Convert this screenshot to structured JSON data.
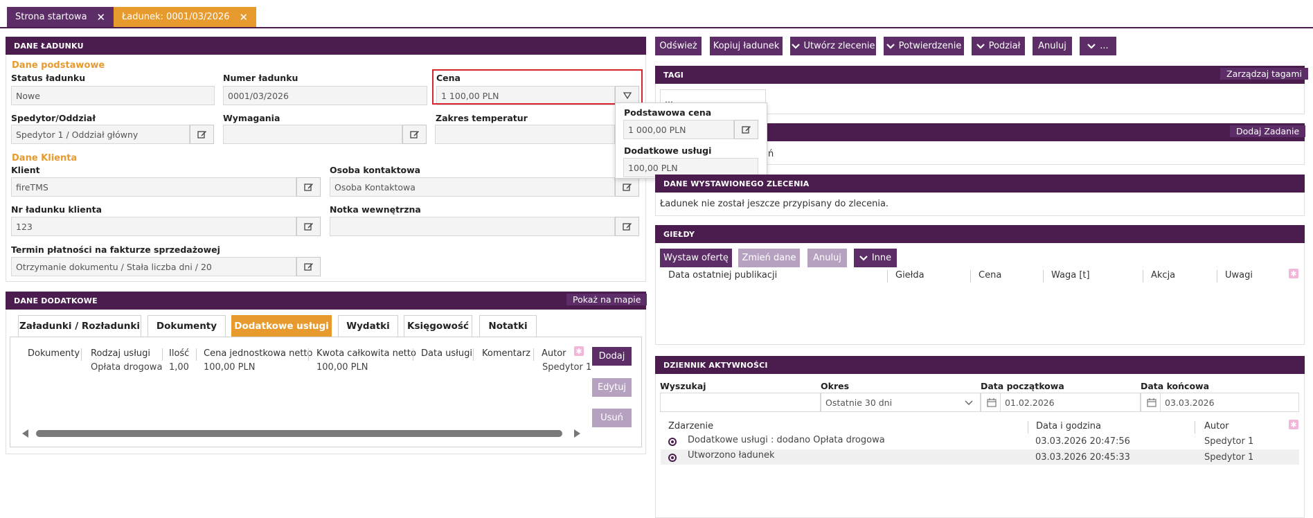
{
  "tabs": [
    {
      "label": "Strona startowa"
    },
    {
      "label": "Ładunek: 0001/03/2026"
    }
  ],
  "dane_ladunku": {
    "title": "DANE ŁADUNKU",
    "section_basic": "Dane podstawowe",
    "status_label": "Status ładunku",
    "status_value": "Nowe",
    "number_label": "Numer ładunku",
    "number_value": "0001/03/2026",
    "price_label": "Cena",
    "price_value": "1 100,00 PLN",
    "forwarder_label": "Spedytor/Oddział",
    "forwarder_value": "Spedytor 1 / Oddział główny",
    "requirements_label": "Wymagania",
    "requirements_value": "",
    "temp_label": "Zakres temperatur",
    "temp_value": "",
    "section_client": "Dane Klienta",
    "client_label": "Klient",
    "client_value": "fireTMS",
    "contact_label": "Osoba kontaktowa",
    "contact_value": "Osoba Kontaktowa",
    "client_no_label": "Nr ładunku klienta",
    "client_no_value": "123",
    "note_label": "Notka wewnętrzna",
    "note_value": "",
    "payment_label": "Termin płatności na fakturze sprzedażowej",
    "payment_value": "Otrzymanie dokumentu / Stała liczba dni / 20"
  },
  "price_popup": {
    "base_label": "Podstawowa cena",
    "base_value": "1 000,00 PLN",
    "extra_label": "Dodatkowe usługi",
    "extra_value": "100,00 PLN"
  },
  "dane_dodatkowe": {
    "title": "DANE DODATKOWE",
    "map_button": "Pokaż na mapie",
    "tabs": [
      "Załadunki / Rozładunki",
      "Dokumenty",
      "Dodatkowe usługi",
      "Wydatki",
      "Księgowość",
      "Notatki"
    ],
    "columns": [
      "Dokumenty",
      "Rodzaj usługi",
      "Ilość",
      "Cena jednostkowa netto",
      "Kwota całkowita netto",
      "Data usługi",
      "Komentarz",
      "Autor"
    ],
    "rows": [
      {
        "type": "Opłata drogowa",
        "qty": "1,00",
        "unit_price": "100,00 PLN",
        "total": "100,00 PLN",
        "author": "Spedytor 1"
      }
    ],
    "btn_add": "Dodaj",
    "btn_edit": "Edytuj",
    "btn_delete": "Usuń"
  },
  "toolbar": {
    "refresh": "Odśwież",
    "copy": "Kopiuj ładunek",
    "create_order": "Utwórz zlecenie",
    "confirmation": "Potwierdzenie",
    "split": "Podział",
    "cancel": "Anuluj",
    "more": "..."
  },
  "tagi": {
    "title": "TAGI",
    "manage": "Zarządzaj tagami",
    "select_value": "..."
  },
  "zadania": {
    "add": "Dodaj Zadanie",
    "partial_text": "ń"
  },
  "zlecenie": {
    "title": "DANE WYSTAWIONEGO ZLECENIA",
    "text": "Ładunek nie został jeszcze przypisany do zlecenia."
  },
  "gieldy": {
    "title": "GIEŁDY",
    "btn_offer": "Wystaw ofertę",
    "btn_change": "Zmień dane",
    "btn_cancel": "Anuluj",
    "btn_other": "Inne",
    "columns": [
      "Data ostatniej publikacji",
      "Giełda",
      "Cena",
      "Waga [t]",
      "Akcja",
      "Uwagi"
    ]
  },
  "dziennik": {
    "title": "DZIENNIK AKTYWNOŚCI",
    "search_label": "Wyszukaj",
    "search_value": "",
    "period_label": "Okres",
    "period_value": "Ostatnie 30 dni",
    "start_label": "Data początkowa",
    "start_value": "01.02.2026",
    "end_label": "Data końcowa",
    "end_value": "03.03.2026",
    "columns": [
      "Zdarzenie",
      "Data i godzina",
      "Autor"
    ],
    "events": [
      {
        "event": "Dodatkowe usługi : dodano Opłata drogowa",
        "datetime": "03.03.2026 20:47:56",
        "author": "Spedytor 1"
      },
      {
        "event": "Utworzono ładunek",
        "datetime": "03.03.2026 20:45:33",
        "author": "Spedytor 1"
      }
    ]
  },
  "colors": {
    "header": "#4b1d4f",
    "button": "#5c2d67",
    "accent": "#e79a2e",
    "highlight": "#d9232d"
  }
}
